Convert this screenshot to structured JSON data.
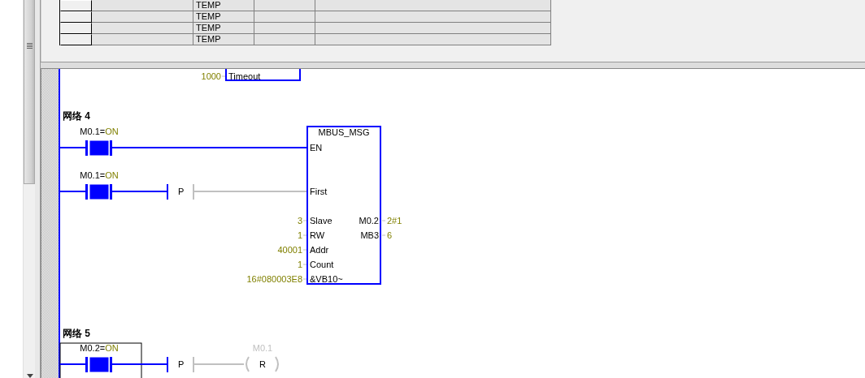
{
  "variable_table": {
    "rows": [
      {
        "column_3": "TEMP"
      },
      {
        "column_3": "TEMP"
      },
      {
        "column_3": "TEMP"
      },
      {
        "column_3": "TEMP"
      }
    ]
  },
  "ladder": {
    "previous_network": {
      "inputs": [
        {
          "value": "1000",
          "pin": "Timeout"
        }
      ]
    },
    "networks": [
      {
        "title": "网络 4",
        "rungs": [
          {
            "contact": "M0.1=",
            "status": "ON",
            "powered": true,
            "selected": false
          },
          {
            "contact": "M0.1=",
            "status": "ON",
            "powered": true,
            "selected": false,
            "edge": "P",
            "output_powered": false
          }
        ],
        "box": {
          "name": "MBUS_MSG",
          "inputs": [
            {
              "pin": "EN"
            },
            {
              "pin": "First"
            },
            {
              "pin": "Slave",
              "value": "3"
            },
            {
              "pin": "RW",
              "value": "1"
            },
            {
              "pin": "Addr",
              "value": "40001"
            },
            {
              "pin": "Count",
              "value": "1"
            },
            {
              "pin": "&VB10~",
              "value": "16#080003E8"
            }
          ],
          "outputs": [
            {
              "pin": "M0.2",
              "value": "2#1"
            },
            {
              "pin": "MB3",
              "value": "6"
            }
          ]
        }
      },
      {
        "title": "网络 5",
        "rungs": [
          {
            "contact": "M0.2=",
            "status": "ON",
            "powered": true,
            "selected": true,
            "edge": "P",
            "output_powered": false,
            "coil": {
              "address": "M0.1",
              "type": "R"
            }
          }
        ]
      }
    ]
  }
}
